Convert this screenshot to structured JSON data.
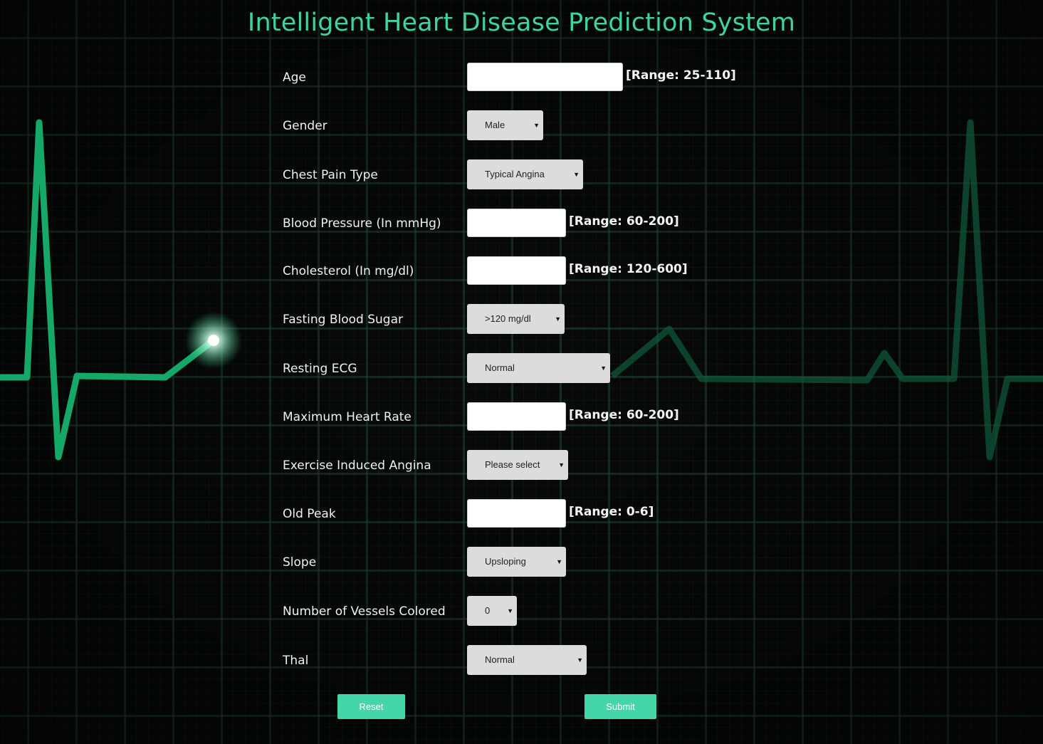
{
  "title": "Intelligent Heart Disease Prediction System",
  "fields": {
    "age": {
      "label": "Age",
      "value": "",
      "range": "[Range: 25-110]"
    },
    "gender": {
      "label": "Gender",
      "selected": "Male"
    },
    "chest_pain": {
      "label": "Chest Pain Type",
      "selected": "Typical Angina"
    },
    "blood_pressure": {
      "label": "Blood Pressure (In mmHg)",
      "value": "",
      "range": "[Range: 60-200]"
    },
    "cholesterol": {
      "label": "Cholesterol (In mg/dl)",
      "value": "",
      "range": "[Range: 120-600]"
    },
    "fasting_sugar": {
      "label": "Fasting Blood Sugar",
      "selected": ">120 mg/dl"
    },
    "resting_ecg": {
      "label": "Resting ECG",
      "selected": "Normal"
    },
    "max_heart_rate": {
      "label": "Maximum Heart Rate",
      "value": "",
      "range": "[Range: 60-200]"
    },
    "exercise_angina": {
      "label": "Exercise Induced Angina",
      "selected": "Please select"
    },
    "old_peak": {
      "label": "Old Peak",
      "value": "",
      "range": "[Range: 0-6]"
    },
    "slope": {
      "label": "Slope",
      "selected": "Upsloping"
    },
    "vessels": {
      "label": "Number of Vessels Colored",
      "selected": "0"
    },
    "thal": {
      "label": "Thal",
      "selected": "Normal"
    }
  },
  "buttons": {
    "reset": "Reset",
    "submit": "Submit"
  },
  "colors": {
    "accent": "#44d6a8",
    "title": "#3fd3a4",
    "ecg_line": "#1fb97a"
  },
  "icons": {
    "dropdown": "caret-down-icon"
  }
}
